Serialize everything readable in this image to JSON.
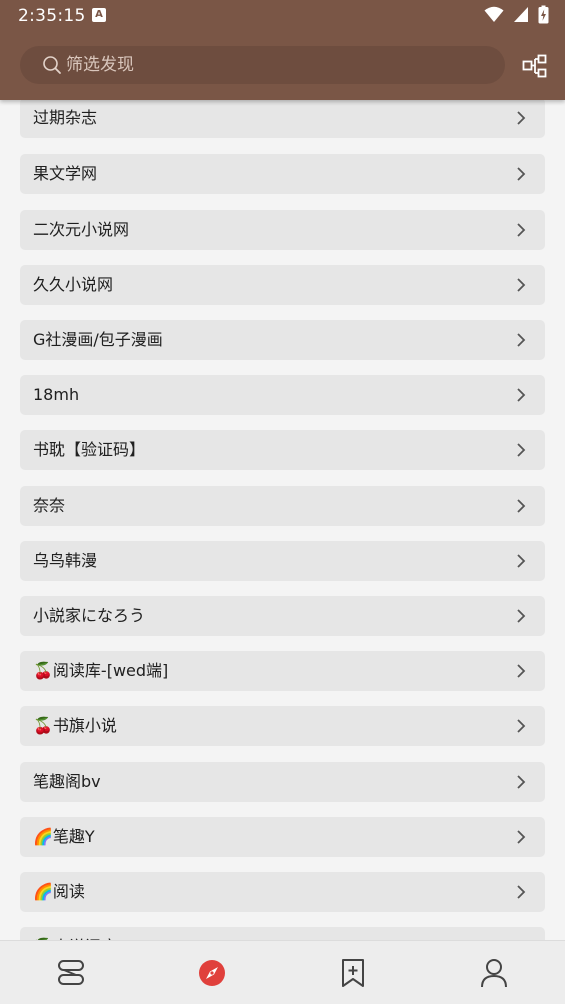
{
  "status_bar": {
    "time": "2:35:15",
    "notification_badge": "A"
  },
  "search": {
    "placeholder": "筛选发现"
  },
  "colors": {
    "app_bar": "#7a5646",
    "search_field": "#6e4d3f",
    "item_background": "#e6e6e6",
    "active_nav": "#e0403c"
  },
  "explore_items": [
    {
      "label": "过期杂志"
    },
    {
      "label": "果文学网"
    },
    {
      "label": "二次元小说网"
    },
    {
      "label": "久久小说网"
    },
    {
      "label": "G社漫画/包子漫画"
    },
    {
      "label": "18mh"
    },
    {
      "label": "书耽【验证码】"
    },
    {
      "label": "奈奈"
    },
    {
      "label": "乌鸟韩漫"
    },
    {
      "label": "小説家になろう"
    },
    {
      "label": "🍒阅读库-[wed端]"
    },
    {
      "label": "🍒书旗小说"
    },
    {
      "label": "笔趣阁bv"
    },
    {
      "label": "🌈笔趣Y"
    },
    {
      "label": "🌈阅读"
    },
    {
      "label": "🍒小说阅库"
    }
  ],
  "bottom_nav": [
    {
      "icon": "bookshelf-icon",
      "active": false
    },
    {
      "icon": "compass-icon",
      "active": true
    },
    {
      "icon": "bookmark-add-icon",
      "active": false
    },
    {
      "icon": "person-icon",
      "active": false
    }
  ]
}
